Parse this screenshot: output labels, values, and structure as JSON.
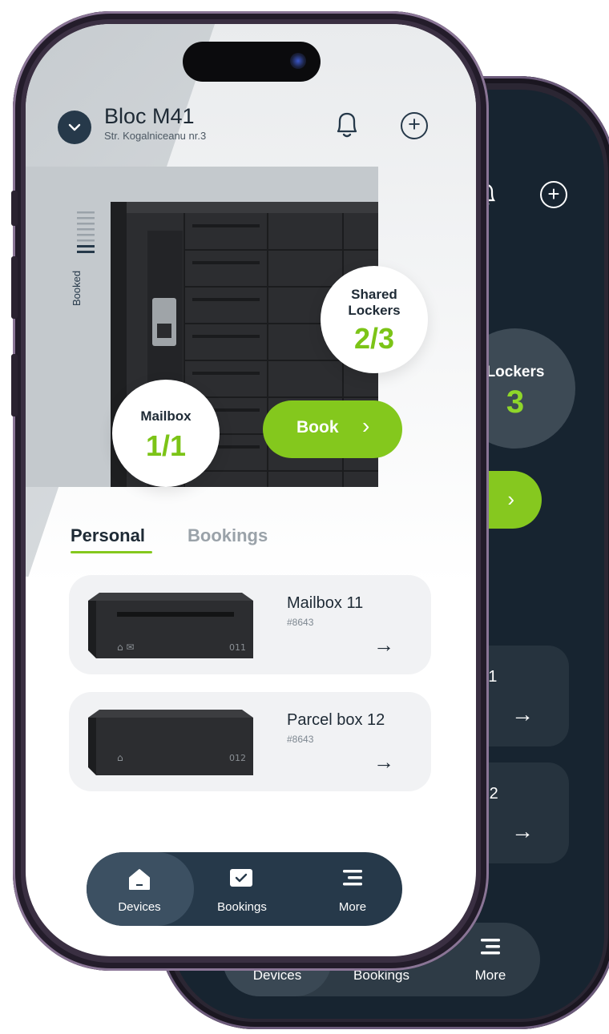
{
  "location": {
    "name": "Bloc M41",
    "address": "Str. Kogalniceanu nr.3"
  },
  "meter": {
    "label": "Booked"
  },
  "shared_lockers": {
    "label_line1": "Shared",
    "label_line2": "Lockers",
    "count": "2/3"
  },
  "mailbox_summary": {
    "label": "Mailbox",
    "count": "1/1"
  },
  "book_button": {
    "label": "Book",
    "chevron": "›"
  },
  "tabs": [
    {
      "label": "Personal",
      "active": true
    },
    {
      "label": "Bookings",
      "active": false
    }
  ],
  "devices": [
    {
      "name": "Mailbox 11",
      "id": "#8643",
      "number": "011",
      "type": "mailbox"
    },
    {
      "name": "Parcel box 12",
      "id": "#8643",
      "number": "012",
      "type": "parcel"
    }
  ],
  "nav": [
    {
      "label": "Devices",
      "icon": "home-icon",
      "active": true
    },
    {
      "label": "Bookings",
      "icon": "check-box-icon",
      "active": false
    },
    {
      "label": "More",
      "icon": "menu-icon",
      "active": false
    }
  ],
  "back_phone": {
    "shared_label": "Lockers",
    "shared_count": "3",
    "card1": "x 11",
    "card2": "x 12",
    "nav": [
      "Devices",
      "Bookings",
      "More"
    ]
  },
  "colors": {
    "accent": "#84c81d",
    "dark": "#26394a",
    "dark_screen": "#172430"
  }
}
